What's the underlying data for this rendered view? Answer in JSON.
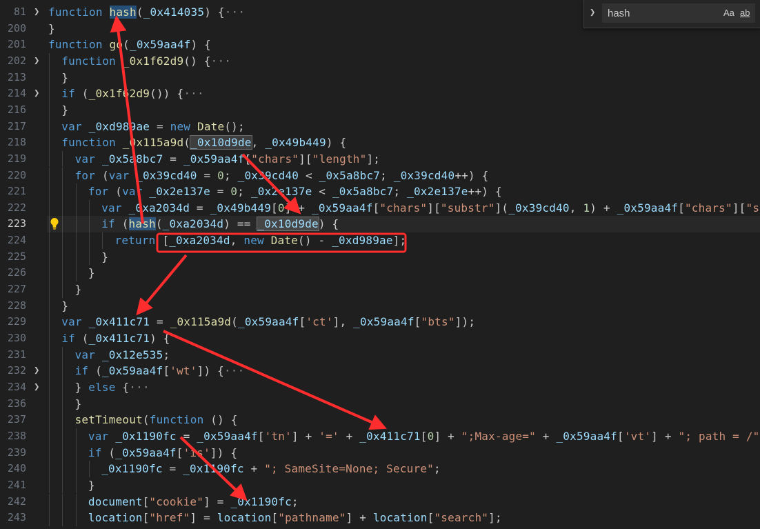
{
  "find_widget": {
    "query": "hash",
    "match_case_label": "Aa",
    "whole_word_label": "ab"
  },
  "lines": [
    {
      "n": "81",
      "fold": true,
      "indent": 0,
      "tokens": [
        [
          "kw",
          "function "
        ],
        [
          "fn sel",
          "hash"
        ],
        [
          "pl",
          "("
        ],
        [
          "id",
          "_0x414035"
        ],
        [
          "pl",
          ") {"
        ],
        [
          "ellipsis",
          "···"
        ]
      ]
    },
    {
      "n": "200",
      "indent": 0,
      "tokens": [
        [
          "pl",
          "}"
        ]
      ]
    },
    {
      "n": "201",
      "indent": 0,
      "tokens": [
        [
          "kw",
          "function "
        ],
        [
          "fn",
          "go"
        ],
        [
          "pl",
          "("
        ],
        [
          "id",
          "_0x59aa4f"
        ],
        [
          "pl",
          ") {"
        ]
      ]
    },
    {
      "n": "202",
      "fold": true,
      "indent": 1,
      "tokens": [
        [
          "kw",
          "function "
        ],
        [
          "fn",
          "_0x1f62d9"
        ],
        [
          "pl",
          "() {"
        ],
        [
          "ellipsis",
          "···"
        ]
      ]
    },
    {
      "n": "213",
      "indent": 1,
      "tokens": [
        [
          "pl",
          "}"
        ]
      ]
    },
    {
      "n": "214",
      "fold": true,
      "indent": 1,
      "tokens": [
        [
          "kw",
          "if "
        ],
        [
          "pl",
          "("
        ],
        [
          "fn",
          "_0x1f62d9"
        ],
        [
          "pl",
          "()) {"
        ],
        [
          "ellipsis",
          "···"
        ]
      ]
    },
    {
      "n": "216",
      "indent": 1,
      "tokens": [
        [
          "pl",
          "}"
        ]
      ]
    },
    {
      "n": "217",
      "indent": 1,
      "tokens": [
        [
          "kw",
          "var "
        ],
        [
          "id",
          "_0xd989ae"
        ],
        [
          "pl",
          " = "
        ],
        [
          "kw",
          "new "
        ],
        [
          "fn",
          "Date"
        ],
        [
          "pl",
          "();"
        ]
      ]
    },
    {
      "n": "218",
      "indent": 1,
      "tokens": [
        [
          "kw",
          "function "
        ],
        [
          "fn",
          "_0x115a9d"
        ],
        [
          "pl",
          "("
        ],
        [
          "id hlbox",
          "_0x10d9de"
        ],
        [
          "pl",
          ", "
        ],
        [
          "id",
          "_0x49b449"
        ],
        [
          "pl",
          ") {"
        ]
      ]
    },
    {
      "n": "219",
      "indent": 2,
      "tokens": [
        [
          "kw",
          "var "
        ],
        [
          "id",
          "_0x5a8bc7"
        ],
        [
          "pl",
          " = "
        ],
        [
          "id",
          "_0x59aa4f"
        ],
        [
          "pl",
          "["
        ],
        [
          "str",
          "\"chars\""
        ],
        [
          "pl",
          "]["
        ],
        [
          "str",
          "\"length\""
        ],
        [
          "pl",
          "];"
        ]
      ]
    },
    {
      "n": "220",
      "indent": 2,
      "tokens": [
        [
          "kw",
          "for "
        ],
        [
          "pl",
          "("
        ],
        [
          "kw",
          "var "
        ],
        [
          "id",
          "_0x39cd40"
        ],
        [
          "pl",
          " = "
        ],
        [
          "num",
          "0"
        ],
        [
          "pl",
          "; "
        ],
        [
          "id",
          "_0x39cd40"
        ],
        [
          "pl",
          " < "
        ],
        [
          "id",
          "_0x5a8bc7"
        ],
        [
          "pl",
          "; "
        ],
        [
          "id",
          "_0x39cd40"
        ],
        [
          "pl",
          "++) {"
        ]
      ]
    },
    {
      "n": "221",
      "indent": 3,
      "tokens": [
        [
          "kw",
          "for "
        ],
        [
          "pl",
          "("
        ],
        [
          "kw",
          "var "
        ],
        [
          "id",
          "_0x2e137e"
        ],
        [
          "pl",
          " = "
        ],
        [
          "num",
          "0"
        ],
        [
          "pl",
          "; "
        ],
        [
          "id",
          "_0x2e137e"
        ],
        [
          "pl",
          " < "
        ],
        [
          "id",
          "_0x5a8bc7"
        ],
        [
          "pl",
          "; "
        ],
        [
          "id",
          "_0x2e137e"
        ],
        [
          "pl",
          "++) {"
        ]
      ]
    },
    {
      "n": "222",
      "indent": 4,
      "tokens": [
        [
          "kw",
          "var "
        ],
        [
          "id",
          "_0xa2034d"
        ],
        [
          "pl",
          " = "
        ],
        [
          "id",
          "_0x49b449"
        ],
        [
          "pl",
          "["
        ],
        [
          "num",
          "0"
        ],
        [
          "pl",
          "] + "
        ],
        [
          "id",
          "_0x59aa4f"
        ],
        [
          "pl",
          "["
        ],
        [
          "str",
          "\"chars\""
        ],
        [
          "pl",
          "]["
        ],
        [
          "str",
          "\"substr\""
        ],
        [
          "pl",
          "]("
        ],
        [
          "id",
          "_0x39cd40"
        ],
        [
          "pl",
          ", "
        ],
        [
          "num",
          "1"
        ],
        [
          "pl",
          ") + "
        ],
        [
          "id",
          "_0x59aa4f"
        ],
        [
          "pl",
          "["
        ],
        [
          "str",
          "\"chars\""
        ],
        [
          "pl",
          "]["
        ],
        [
          "str",
          "\"subs"
        ]
      ]
    },
    {
      "n": "223",
      "current": true,
      "bulb": true,
      "indent": 4,
      "tokens": [
        [
          "kw",
          "if "
        ],
        [
          "pl",
          "("
        ],
        [
          "fn sel",
          "hash"
        ],
        [
          "pl",
          "("
        ],
        [
          "id",
          "_0xa2034d"
        ],
        [
          "pl",
          ") == "
        ],
        [
          "id hlbox",
          "_0x10d9de"
        ],
        [
          "pl",
          ") {"
        ]
      ]
    },
    {
      "n": "224",
      "indent": 5,
      "tokens": [
        [
          "kw",
          "return "
        ],
        [
          "pl",
          "["
        ],
        [
          "id",
          "_0xa2034d"
        ],
        [
          "pl",
          ", "
        ],
        [
          "kw",
          "new "
        ],
        [
          "fn",
          "Date"
        ],
        [
          "pl",
          "() - "
        ],
        [
          "id",
          "_0xd989ae"
        ],
        [
          "pl",
          "];"
        ]
      ]
    },
    {
      "n": "225",
      "indent": 4,
      "tokens": [
        [
          "pl",
          "}"
        ]
      ]
    },
    {
      "n": "226",
      "indent": 3,
      "tokens": [
        [
          "pl",
          "}"
        ]
      ]
    },
    {
      "n": "227",
      "indent": 2,
      "tokens": [
        [
          "pl",
          "}"
        ]
      ]
    },
    {
      "n": "228",
      "indent": 1,
      "tokens": [
        [
          "pl",
          "}"
        ]
      ]
    },
    {
      "n": "229",
      "indent": 1,
      "tokens": [
        [
          "kw",
          "var "
        ],
        [
          "id",
          "_0x411c71"
        ],
        [
          "pl",
          " = "
        ],
        [
          "fn",
          "_0x115a9d"
        ],
        [
          "pl",
          "("
        ],
        [
          "id",
          "_0x59aa4f"
        ],
        [
          "pl",
          "["
        ],
        [
          "str",
          "'ct'"
        ],
        [
          "pl",
          "], "
        ],
        [
          "id",
          "_0x59aa4f"
        ],
        [
          "pl",
          "["
        ],
        [
          "str",
          "\"bts\""
        ],
        [
          "pl",
          "]);"
        ]
      ]
    },
    {
      "n": "230",
      "indent": 1,
      "tokens": [
        [
          "kw",
          "if "
        ],
        [
          "pl",
          "("
        ],
        [
          "id",
          "_0x411c71"
        ],
        [
          "pl",
          ") {"
        ]
      ]
    },
    {
      "n": "231",
      "indent": 2,
      "tokens": [
        [
          "kw",
          "var "
        ],
        [
          "id",
          "_0x12e535"
        ],
        [
          "pl",
          ";"
        ]
      ]
    },
    {
      "n": "232",
      "fold": true,
      "indent": 2,
      "tokens": [
        [
          "kw",
          "if "
        ],
        [
          "pl",
          "("
        ],
        [
          "id",
          "_0x59aa4f"
        ],
        [
          "pl",
          "["
        ],
        [
          "str",
          "'wt'"
        ],
        [
          "pl",
          "]) {"
        ],
        [
          "ellipsis",
          "···"
        ]
      ]
    },
    {
      "n": "234",
      "fold": true,
      "indent": 2,
      "tokens": [
        [
          "pl",
          "} "
        ],
        [
          "kw",
          "else "
        ],
        [
          "pl",
          "{"
        ],
        [
          "ellipsis",
          "···"
        ]
      ]
    },
    {
      "n": "236",
      "indent": 2,
      "tokens": [
        [
          "pl",
          "}"
        ]
      ]
    },
    {
      "n": "237",
      "indent": 2,
      "tokens": [
        [
          "fn",
          "setTimeout"
        ],
        [
          "pl",
          "("
        ],
        [
          "kw",
          "function "
        ],
        [
          "pl",
          "() {"
        ]
      ]
    },
    {
      "n": "238",
      "indent": 3,
      "tokens": [
        [
          "kw",
          "var "
        ],
        [
          "id",
          "_0x1190fc"
        ],
        [
          "pl",
          " = "
        ],
        [
          "id",
          "_0x59aa4f"
        ],
        [
          "pl",
          "["
        ],
        [
          "str",
          "'tn'"
        ],
        [
          "pl",
          "] + "
        ],
        [
          "str",
          "'='"
        ],
        [
          "pl",
          " + "
        ],
        [
          "id",
          "_0x411c71"
        ],
        [
          "pl",
          "["
        ],
        [
          "num",
          "0"
        ],
        [
          "pl",
          "] + "
        ],
        [
          "str",
          "\";Max-age=\""
        ],
        [
          "pl",
          " + "
        ],
        [
          "id",
          "_0x59aa4f"
        ],
        [
          "pl",
          "["
        ],
        [
          "str",
          "'vt'"
        ],
        [
          "pl",
          "] + "
        ],
        [
          "str",
          "\"; path = /\""
        ],
        [
          "pl",
          ";"
        ]
      ]
    },
    {
      "n": "239",
      "indent": 3,
      "tokens": [
        [
          "kw",
          "if "
        ],
        [
          "pl",
          "("
        ],
        [
          "id",
          "_0x59aa4f"
        ],
        [
          "pl",
          "["
        ],
        [
          "str",
          "'is'"
        ],
        [
          "pl",
          "]) {"
        ]
      ]
    },
    {
      "n": "240",
      "indent": 4,
      "tokens": [
        [
          "id",
          "_0x1190fc"
        ],
        [
          "pl",
          " = "
        ],
        [
          "id",
          "_0x1190fc"
        ],
        [
          "pl",
          " + "
        ],
        [
          "str",
          "\"; SameSite=None; Secure\""
        ],
        [
          "pl",
          ";"
        ]
      ]
    },
    {
      "n": "241",
      "indent": 3,
      "tokens": [
        [
          "pl",
          "}"
        ]
      ]
    },
    {
      "n": "242",
      "indent": 3,
      "tokens": [
        [
          "id",
          "document"
        ],
        [
          "pl",
          "["
        ],
        [
          "str",
          "\"cookie\""
        ],
        [
          "pl",
          "] = "
        ],
        [
          "id",
          "_0x1190fc"
        ],
        [
          "pl",
          ";"
        ]
      ]
    },
    {
      "n": "243",
      "indent": 3,
      "tokens": [
        [
          "id",
          "location"
        ],
        [
          "pl",
          "["
        ],
        [
          "str",
          "\"href\""
        ],
        [
          "pl",
          "] = "
        ],
        [
          "id",
          "location"
        ],
        [
          "pl",
          "["
        ],
        [
          "str",
          "\"pathname\""
        ],
        [
          "pl",
          "] + "
        ],
        [
          "id",
          "location"
        ],
        [
          "pl",
          "["
        ],
        [
          "str",
          "\"search\""
        ],
        [
          "pl",
          "];"
        ]
      ]
    }
  ]
}
